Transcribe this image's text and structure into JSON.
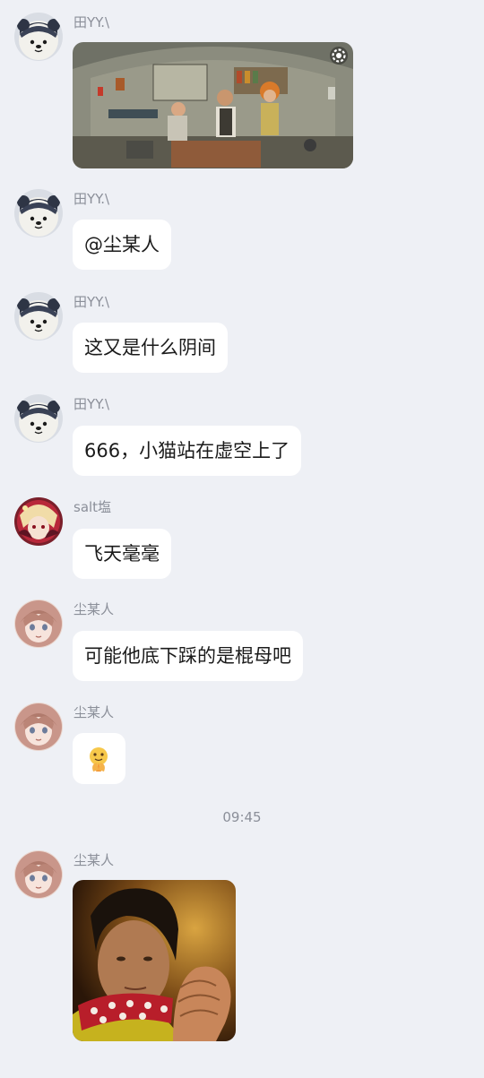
{
  "messages": [
    {
      "sender": "田YY.\\",
      "type": "image",
      "alt": "game screenshot"
    },
    {
      "sender": "田YY.\\",
      "type": "text",
      "text": "@尘某人"
    },
    {
      "sender": "田YY.\\",
      "type": "text",
      "text": "这又是什么阴间"
    },
    {
      "sender": "田YY.\\",
      "type": "text",
      "text": "666，小猫站在虚空上了"
    },
    {
      "sender": "salt塩",
      "type": "text",
      "text": "飞天毫毫"
    },
    {
      "sender": "尘某人",
      "type": "text",
      "text": "可能他底下踩的是棍母吧"
    },
    {
      "sender": "尘某人",
      "type": "sticker",
      "text": "🙏"
    },
    {
      "sender": "尘某人",
      "type": "image",
      "alt": "photo of person with clasped hands"
    }
  ],
  "timestamp": "09:45",
  "colors": {
    "background": "#eef0f5",
    "bubble": "#ffffff",
    "sender_name": "#8b8f99"
  }
}
